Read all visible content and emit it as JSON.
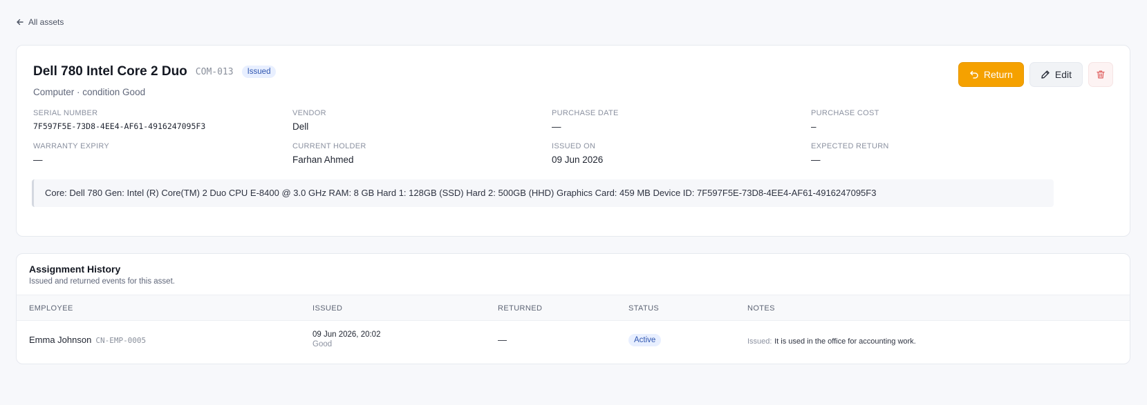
{
  "nav": {
    "back_label": "All assets"
  },
  "asset": {
    "title": "Dell 780 Intel Core 2 Duo",
    "code": "COM-013",
    "status": "Issued",
    "subtitle": "Computer · condition Good",
    "actions": {
      "return_label": "Return",
      "edit_label": "Edit"
    },
    "fields": [
      {
        "label": "SERIAL NUMBER",
        "value": "7F597F5E-73D8-4EE4-AF61-4916247095F3"
      },
      {
        "label": "VENDOR",
        "value": "Dell"
      },
      {
        "label": "PURCHASE DATE",
        "value": "—"
      },
      {
        "label": "PURCHASE COST",
        "value": "–"
      },
      {
        "label": "WARRANTY EXPIRY",
        "value": "—"
      },
      {
        "label": "CURRENT HOLDER",
        "value": "Farhan Ahmed"
      },
      {
        "label": "ISSUED ON",
        "value": "09 Jun 2026"
      },
      {
        "label": "EXPECTED RETURN",
        "value": "—"
      }
    ],
    "notes": "Core: Dell 780 Gen: Intel (R) Core(TM) 2 Duo CPU E-8400 @ 3.0 GHz RAM: 8 GB Hard 1: 128GB (SSD) Hard 2: 500GB (HHD) Graphics Card: 459 MB Device ID: 7F597F5E-73D8-4EE4-AF61-4916247095F3"
  },
  "history": {
    "title": "Assignment History",
    "subtitle": "Issued and returned events for this asset.",
    "columns": [
      "EMPLOYEE",
      "ISSUED",
      "RETURNED",
      "STATUS",
      "NOTES"
    ],
    "rows": [
      {
        "employee": "Emma Johnson",
        "employee_code": "CN-EMP-0005",
        "issued_date": "09 Jun 2026, 20:02",
        "issued_condition": "Good",
        "returned": "—",
        "status": "Active",
        "note_label": "Issued:",
        "note_text": "It is used in the office for accounting work."
      }
    ]
  },
  "colors": {
    "accent": "#f5a100",
    "badge_bg": "#e8efff",
    "badge_text": "#2f56b0",
    "danger": "#e06464"
  },
  "icons": {
    "back": "arrow-left-icon",
    "return": "undo-icon",
    "edit": "pencil-icon",
    "delete": "trash-icon"
  }
}
